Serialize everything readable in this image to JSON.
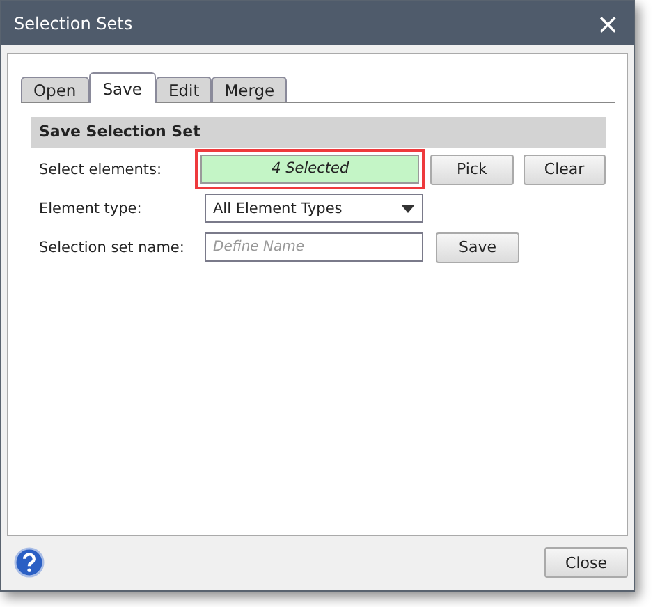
{
  "window": {
    "title": "Selection Sets",
    "close": "×"
  },
  "tabs": [
    {
      "label": "Open",
      "selected": false
    },
    {
      "label": "Save",
      "selected": true
    },
    {
      "label": "Edit",
      "selected": false
    },
    {
      "label": "Merge",
      "selected": false
    }
  ],
  "section": {
    "title": "Save Selection Set"
  },
  "rows": [
    {
      "kind": "selection",
      "label": "Select elements:",
      "value": "4 Selected",
      "highlighted": true,
      "buttons": [
        "Pick",
        "Clear"
      ]
    },
    {
      "kind": "dropdown",
      "label": "Element type:",
      "value": "All Element Types"
    },
    {
      "kind": "text",
      "label": "Selection set name:",
      "placeholder": "Define Name",
      "buttons": [
        "Save"
      ]
    }
  ],
  "footer": {
    "buttons": [
      "Close"
    ]
  }
}
